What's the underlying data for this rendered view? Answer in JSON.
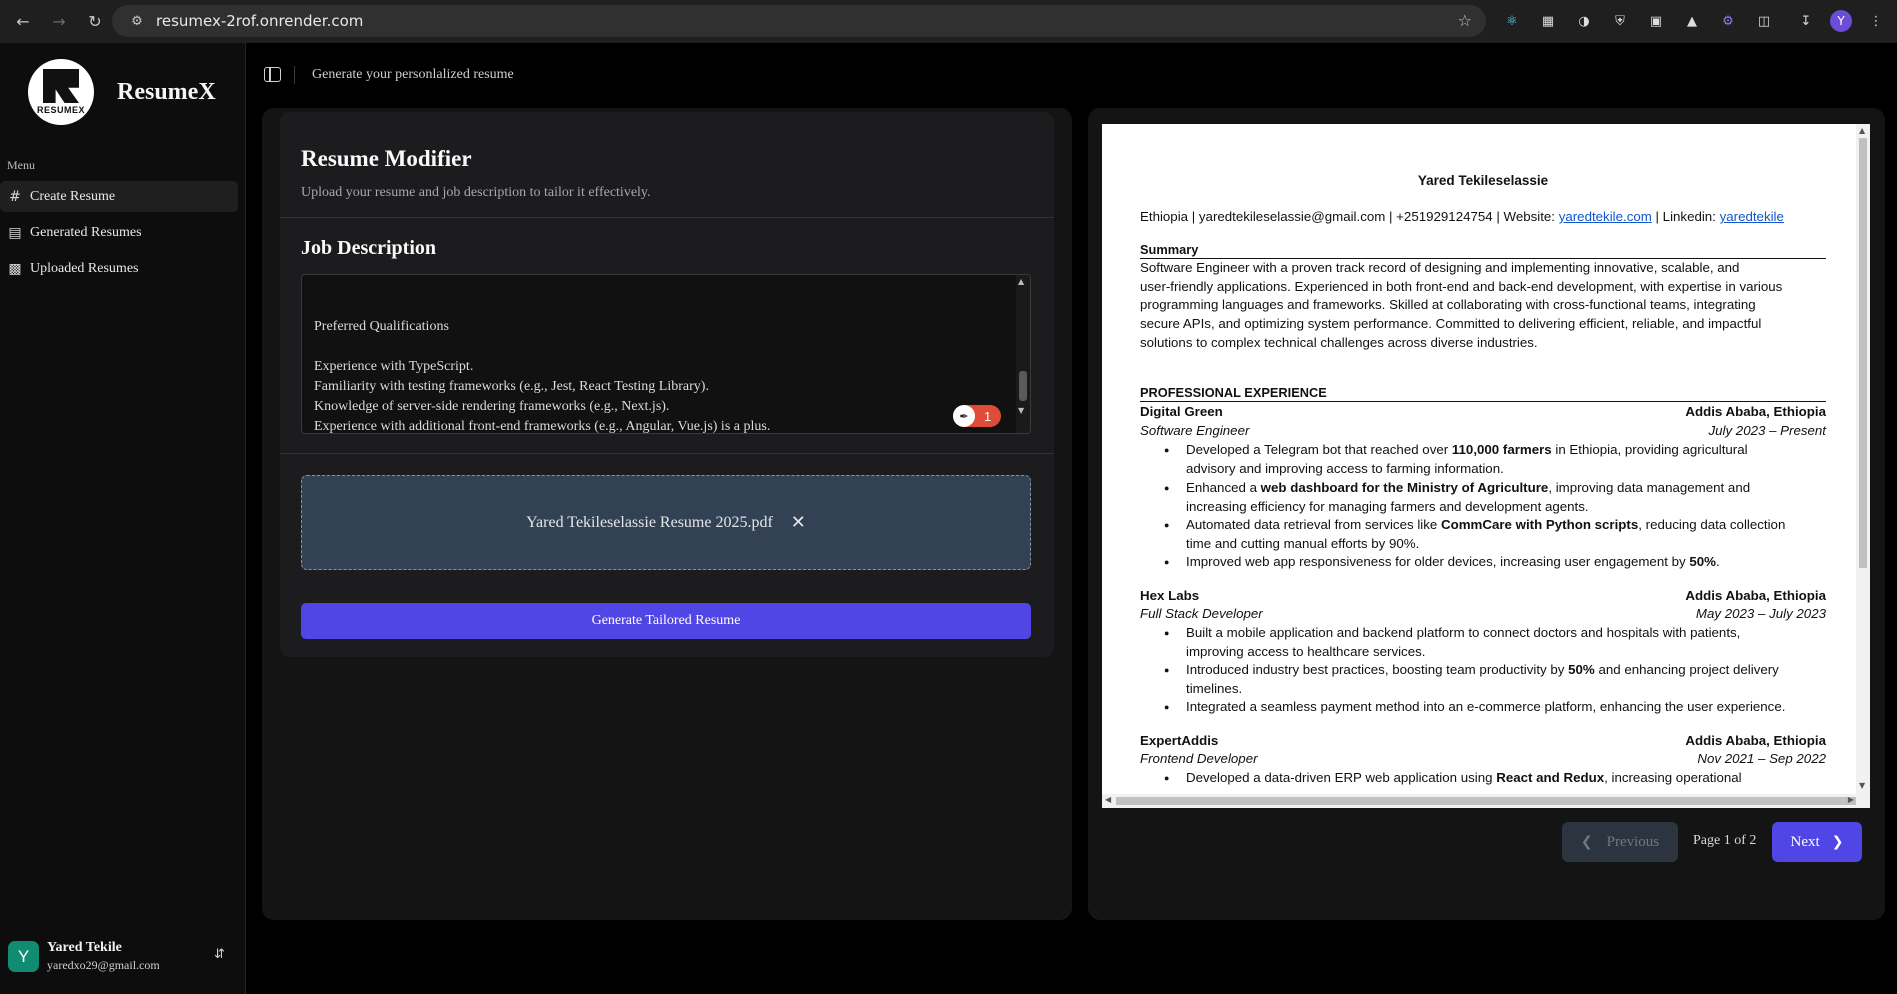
{
  "browser": {
    "url": "resumex-2rof.onrender.com",
    "profile_initial": "Y"
  },
  "sidebar": {
    "logo_text": "RESUMEX",
    "brand": "ResumeX",
    "menu_title": "Menu",
    "items": [
      {
        "label": "Create Resume",
        "icon": "hash-icon",
        "active": true
      },
      {
        "label": "Generated Resumes",
        "icon": "file-icon",
        "active": false
      },
      {
        "label": "Uploaded Resumes",
        "icon": "file-upload-icon",
        "active": false
      }
    ],
    "user": {
      "initial": "Y",
      "name": "Yared Tekile",
      "email": "yaredxo29@gmail.com"
    }
  },
  "header": {
    "title": "Generate your personlalized resume"
  },
  "modifier": {
    "title": "Resume Modifier",
    "subtitle": "Upload your resume and job description to tailor it effectively.",
    "job_description_title": "Job Description",
    "job_description_text": "Preferred Qualifications\n\nExperience with TypeScript.\nFamiliarity with testing frameworks (e.g., Jest, React Testing Library).\nKnowledge of server-side rendering frameworks (e.g., Next.js).\nExperience with additional front-end frameworks (e.g., Angular, Vue.js) is a plus.",
    "badge_count": "1",
    "uploaded_file": "Yared Tekileselassie Resume 2025.pdf",
    "generate_button": "Generate Tailored Resume"
  },
  "preview": {
    "name": "Yared Tekileselassie",
    "contact_prefix": "Ethiopia | yaredtekileselassie@gmail.com | +251929124754 | Website: ",
    "website_link": "yaredtekile.com",
    "contact_mid": " | Linkedin: ",
    "linkedin_link": "yaredtekile",
    "summary_heading": "Summary",
    "summary_lines": [
      "Software Engineer with a proven track record of designing and implementing innovative, scalable, and",
      "user-friendly applications. Experienced in both front-end and back-end development, with expertise in various",
      "programming languages and frameworks. Skilled at collaborating with cross-functional teams, integrating",
      "secure APIs, and optimizing system performance. Committed to delivering efficient, reliable, and impactful",
      "solutions to complex technical challenges across diverse industries."
    ],
    "experience_heading": "PROFESSIONAL EXPERIENCE",
    "jobs": [
      {
        "company": "Digital Green",
        "location": "Addis Ababa, Ethiopia",
        "role": "Software Engineer",
        "dates": "July 2023 –  Present",
        "bullets": [
          [
            "Developed a Telegram bot that reached over ",
            "110,000 farmers",
            " in Ethiopia, providing agricultural",
            "advisory and improving access to farming information."
          ],
          [
            "Enhanced a ",
            "web dashboard for the Ministry of Agriculture",
            ", improving data management and",
            "increasing efficiency for managing farmers and development agents."
          ],
          [
            "Automated data retrieval from services like ",
            "CommCare with Python scripts",
            ", reducing data collection",
            "time and cutting manual efforts by 90%."
          ],
          [
            "Improved web app responsiveness for older devices, increasing user engagement by ",
            "50%",
            ".",
            ""
          ]
        ]
      },
      {
        "company": "Hex Labs",
        "location": "Addis Ababa, Ethiopia",
        "role": "Full Stack Developer",
        "dates": "May 2023 – July 2023",
        "bullets": [
          [
            "Built a mobile application and backend platform to connect doctors and hospitals with patients,",
            "",
            "",
            "improving access to healthcare services."
          ],
          [
            "Introduced industry best practices, boosting team productivity by ",
            "50%",
            " and enhancing project delivery",
            "timelines."
          ],
          [
            "Integrated a seamless payment method into an e-commerce platform, enhancing the user experience.",
            "",
            "",
            ""
          ]
        ]
      },
      {
        "company": "ExpertAddis",
        "location": "Addis Ababa, Ethiopia",
        "role": "Frontend Developer",
        "dates": "Nov 2021 – Sep 2022",
        "bullets": [
          [
            "Developed a data-driven ERP web application using ",
            "React and Redux",
            ", increasing operational",
            ""
          ]
        ]
      }
    ],
    "pagination": {
      "previous": "Previous",
      "page_indicator": "Page 1 of 2",
      "next": "Next"
    }
  }
}
